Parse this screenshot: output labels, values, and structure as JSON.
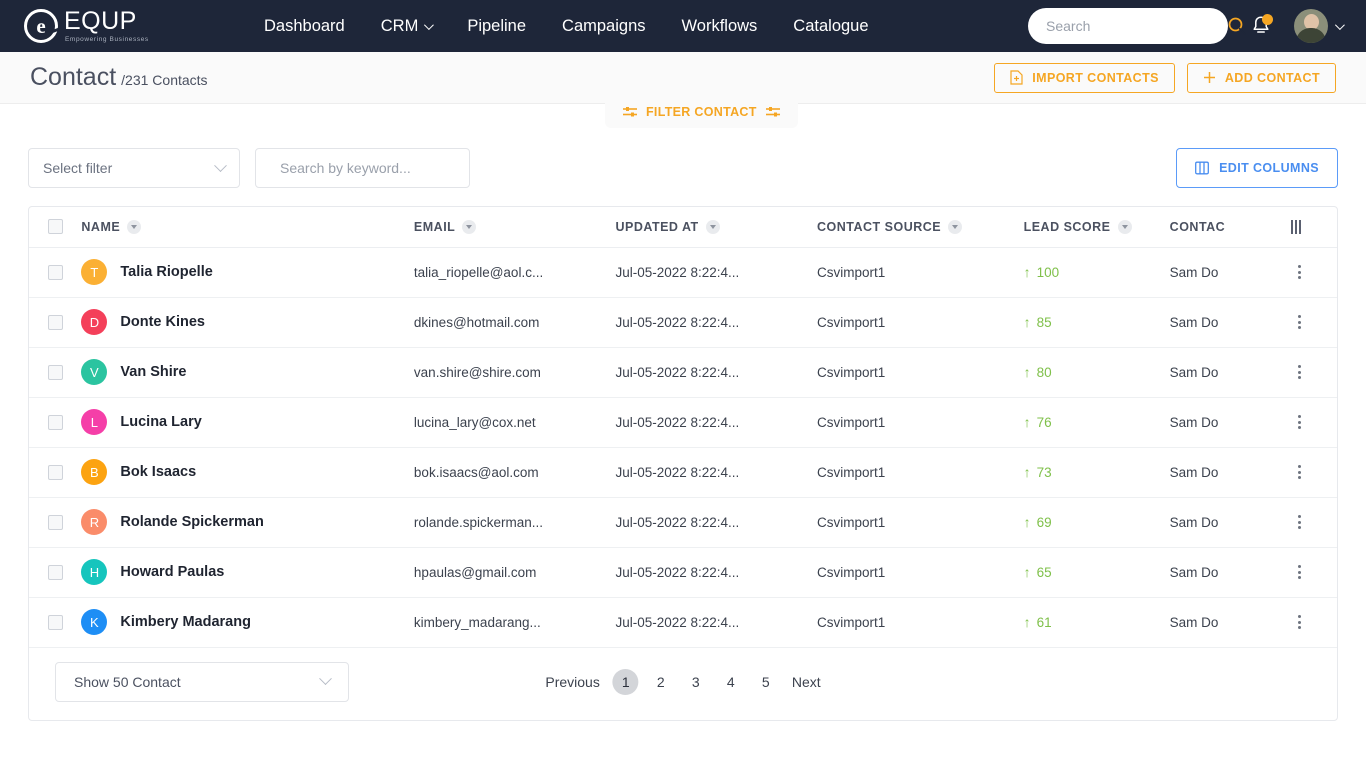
{
  "brand": {
    "logo_letter": "e",
    "name": "EQUP",
    "tagline": "Empowering Businesses",
    "accent_orange": "#f5a623",
    "accent_blue": "#4a8ef0",
    "nav_bg": "#1e2639",
    "lead_green": "#7fc04a"
  },
  "nav": {
    "items": [
      {
        "label": "Dashboard",
        "has_caret": false
      },
      {
        "label": "CRM",
        "has_caret": true
      },
      {
        "label": "Pipeline",
        "has_caret": false
      },
      {
        "label": "Campaigns",
        "has_caret": false
      },
      {
        "label": "Workflows",
        "has_caret": false
      },
      {
        "label": "Catalogue",
        "has_caret": false
      }
    ],
    "search_placeholder": "Search",
    "search_value": ""
  },
  "page": {
    "title": "Contact",
    "subtitle": "/231 Contacts",
    "import_label": "IMPORT CONTACTS",
    "add_label": "ADD CONTACT",
    "filter_tab_label": "FILTER CONTACT"
  },
  "toolbar": {
    "select_filter_label": "Select filter",
    "keyword_placeholder": "Search by keyword...",
    "keyword_value": "",
    "edit_columns_label": "EDIT COLUMNS"
  },
  "table": {
    "columns": [
      {
        "label": "NAME"
      },
      {
        "label": "EMAIL"
      },
      {
        "label": "UPDATED AT"
      },
      {
        "label": "CONTACT SOURCE"
      },
      {
        "label": "LEAD SCORE"
      },
      {
        "label": "CONTAC"
      }
    ],
    "rows": [
      {
        "initial": "T",
        "color": "#fbb034",
        "name": "Talia Riopelle",
        "email": "talia_riopelle@aol.c...",
        "updated": "Jul-05-2022 8:22:4...",
        "source": "Csvimport1",
        "score": "100",
        "owner": "Sam Do"
      },
      {
        "initial": "D",
        "color": "#f4405a",
        "name": "Donte Kines",
        "email": "dkines@hotmail.com",
        "updated": "Jul-05-2022 8:22:4...",
        "source": "Csvimport1",
        "score": "85",
        "owner": "Sam Do"
      },
      {
        "initial": "V",
        "color": "#2bc4a0",
        "name": "Van Shire",
        "email": "van.shire@shire.com",
        "updated": "Jul-05-2022 8:22:4...",
        "source": "Csvimport1",
        "score": "80",
        "owner": "Sam Do"
      },
      {
        "initial": "L",
        "color": "#f53fa8",
        "name": "Lucina Lary",
        "email": "lucina_lary@cox.net",
        "updated": "Jul-05-2022 8:22:4...",
        "source": "Csvimport1",
        "score": "76",
        "owner": "Sam Do"
      },
      {
        "initial": "B",
        "color": "#fca311",
        "name": "Bok Isaacs",
        "email": "bok.isaacs@aol.com",
        "updated": "Jul-05-2022 8:22:4...",
        "source": "Csvimport1",
        "score": "73",
        "owner": "Sam Do"
      },
      {
        "initial": "R",
        "color": "#fa8c6a",
        "name": "Rolande Spickerman",
        "email": "rolande.spickerman...",
        "updated": "Jul-05-2022 8:22:4...",
        "source": "Csvimport1",
        "score": "69",
        "owner": "Sam Do"
      },
      {
        "initial": "H",
        "color": "#16c5bd",
        "name": "Howard Paulas",
        "email": "hpaulas@gmail.com",
        "updated": "Jul-05-2022 8:22:4...",
        "source": "Csvimport1",
        "score": "65",
        "owner": "Sam Do"
      },
      {
        "initial": "K",
        "color": "#1e8ef5",
        "name": "Kimbery Madarang",
        "email": "kimbery_madarang...",
        "updated": "Jul-05-2022 8:22:4...",
        "source": "Csvimport1",
        "score": "61",
        "owner": "Sam Do"
      }
    ]
  },
  "footer": {
    "show_label": "Show 50 Contact",
    "previous_label": "Previous",
    "next_label": "Next",
    "pages": [
      "1",
      "2",
      "3",
      "4",
      "5"
    ],
    "active_page": "1"
  }
}
